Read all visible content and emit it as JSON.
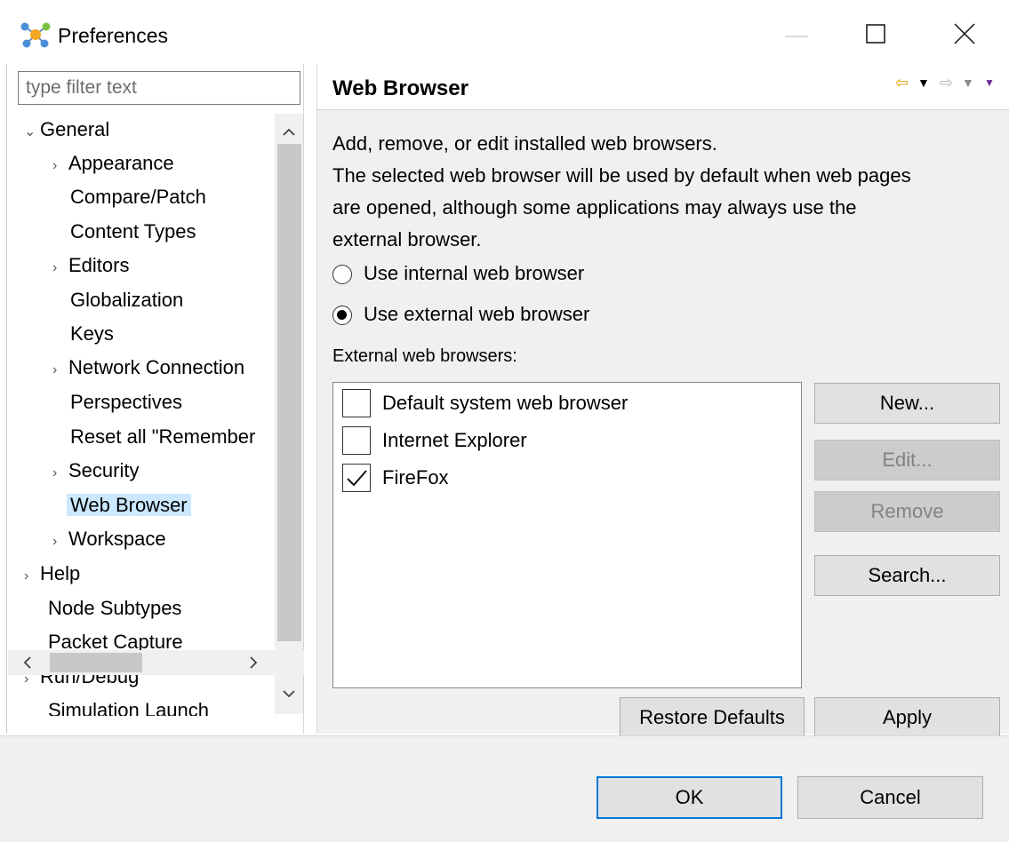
{
  "window": {
    "title": "Preferences",
    "icon": "preferences-icon",
    "controls": [
      "minimize-icon",
      "maximize-icon",
      "close-icon"
    ]
  },
  "sidebar": {
    "filter_placeholder": "type filter text",
    "tree": [
      {
        "label": "General",
        "expander": "open"
      },
      {
        "label": "Appearance",
        "expander": "closed"
      },
      {
        "label": "Compare/Patch",
        "expander": "none"
      },
      {
        "label": "Content Types",
        "expander": "none"
      },
      {
        "label": "Editors",
        "expander": "closed"
      },
      {
        "label": "Globalization",
        "expander": "none"
      },
      {
        "label": "Keys",
        "expander": "none"
      },
      {
        "label": "Network Connection",
        "expander": "closed"
      },
      {
        "label": "Perspectives",
        "expander": "none"
      },
      {
        "label": "Reset all \"Remember",
        "expander": "none"
      },
      {
        "label": "Security",
        "expander": "closed"
      },
      {
        "label": "Web Browser",
        "expander": "none",
        "selected": true
      },
      {
        "label": "Workspace",
        "expander": "closed"
      },
      {
        "label": "Help",
        "expander": "closed"
      },
      {
        "label": "Node Subtypes",
        "expander": "none"
      },
      {
        "label": "Packet Capture",
        "expander": "none"
      },
      {
        "label": "Run/Debug",
        "expander": "closed"
      },
      {
        "label": "Simulation Launch",
        "expander": "none"
      }
    ]
  },
  "page": {
    "title": "Web Browser",
    "nav_icons": [
      "back-arrow-icon",
      "back-menu-icon",
      "forward-arrow-icon",
      "forward-menu-icon",
      "view-menu-icon"
    ],
    "description": [
      "Add, remove, or edit installed web browsers.",
      "The selected web browser will be used by default when web pages",
      "are opened, although some applications may always use the",
      "external browser."
    ],
    "radio_internal": {
      "label": "Use internal web browser",
      "checked": false
    },
    "radio_external": {
      "label": "Use external web browser",
      "checked": true
    },
    "list_label": "External web browsers:",
    "browsers": [
      {
        "label": "Default system web browser",
        "checked": false
      },
      {
        "label": "Internet Explorer",
        "checked": false
      },
      {
        "label": "FireFox",
        "checked": true
      }
    ],
    "buttons": {
      "new": "New...",
      "edit": "Edit...",
      "remove": "Remove",
      "search": "Search...",
      "restore_defaults": "Restore Defaults",
      "apply": "Apply"
    }
  },
  "footer": {
    "ok": "OK",
    "cancel": "Cancel"
  },
  "colors": {
    "selection": "#cce8ff",
    "panel_bg": "#f0f0f0",
    "button_bg": "#e1e1e1",
    "ok_border": "#0078d7",
    "nav_back": "#e8a317"
  }
}
